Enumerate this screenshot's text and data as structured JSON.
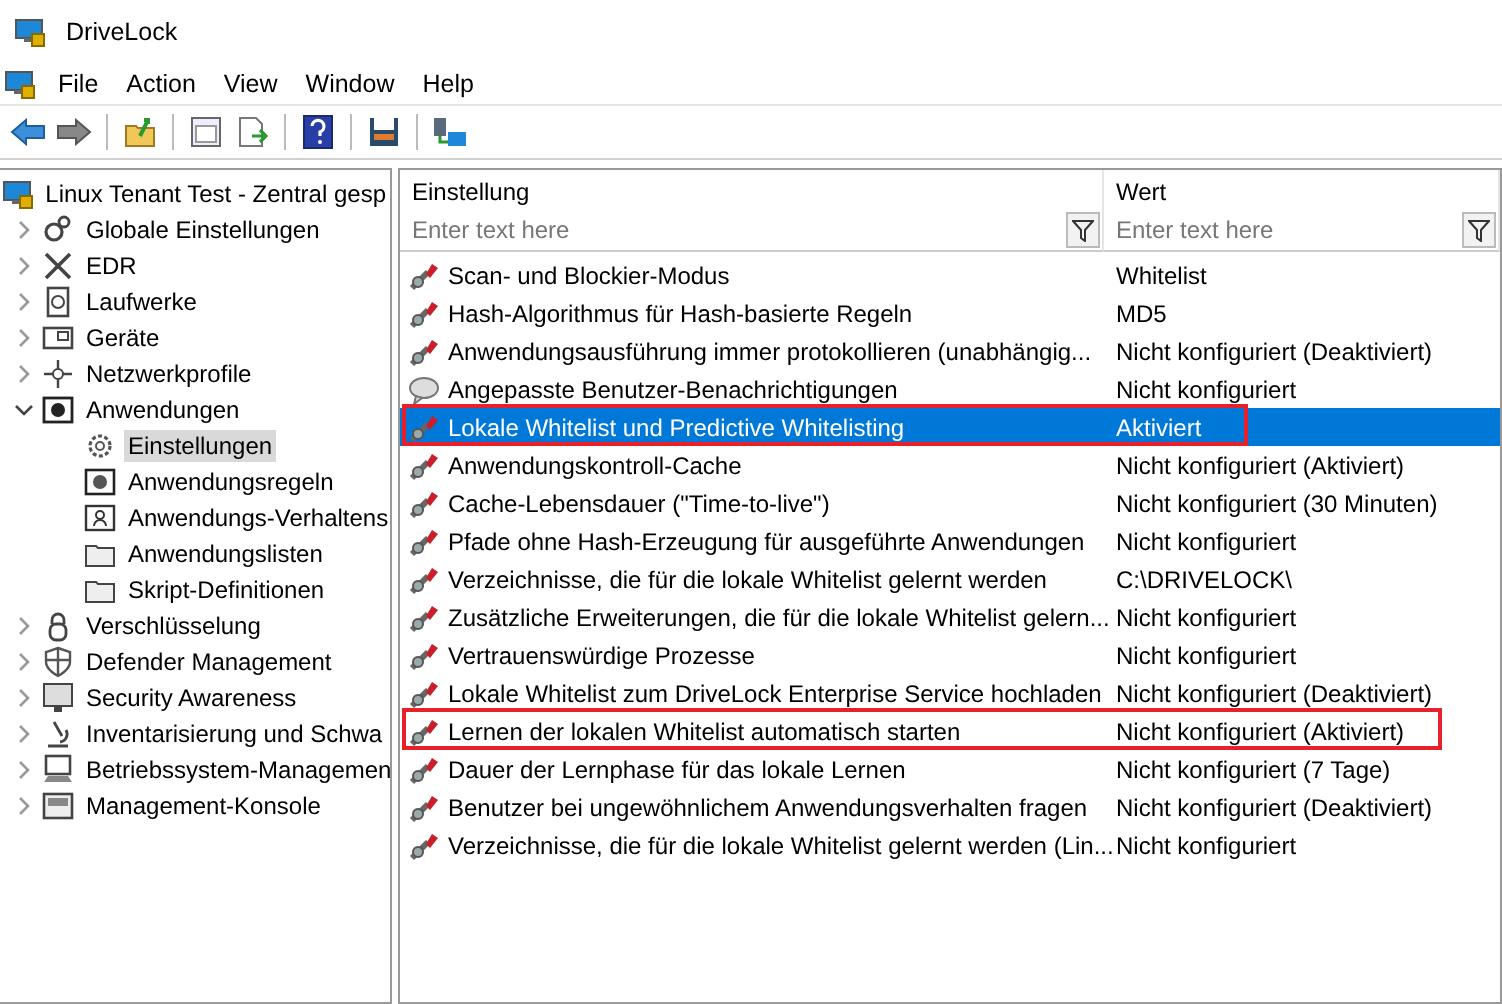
{
  "window": {
    "title": "DriveLock"
  },
  "menu": [
    "File",
    "Action",
    "View",
    "Window",
    "Help"
  ],
  "tree": {
    "label": "Linux Tenant Test - Zentral gesp",
    "children": [
      {
        "label": "Globale Einstellungen",
        "expanded": false,
        "selected": false
      },
      {
        "label": "EDR",
        "expanded": false,
        "selected": false
      },
      {
        "label": "Laufwerke",
        "expanded": false,
        "selected": false
      },
      {
        "label": "Geräte",
        "expanded": false,
        "selected": false
      },
      {
        "label": "Netzwerkprofile",
        "expanded": false,
        "selected": false
      },
      {
        "label": "Anwendungen",
        "expanded": true,
        "selected": false,
        "children": [
          {
            "label": "Einstellungen",
            "selected": true
          },
          {
            "label": "Anwendungsregeln",
            "selected": false
          },
          {
            "label": "Anwendungs-Verhaltens",
            "selected": false
          },
          {
            "label": "Anwendungslisten",
            "selected": false
          },
          {
            "label": "Skript-Definitionen",
            "selected": false
          }
        ]
      },
      {
        "label": "Verschlüsselung",
        "expanded": false,
        "selected": false
      },
      {
        "label": "Defender Management",
        "expanded": false,
        "selected": false
      },
      {
        "label": "Security Awareness",
        "expanded": false,
        "selected": false
      },
      {
        "label": "Inventarisierung und Schwa",
        "expanded": false,
        "selected": false
      },
      {
        "label": "Betriebssystem-Managemen",
        "expanded": false,
        "selected": false
      },
      {
        "label": "Management-Konsole",
        "expanded": false,
        "selected": false
      }
    ]
  },
  "table": {
    "columns": [
      {
        "title": "Einstellung",
        "placeholder": "Enter text here"
      },
      {
        "title": "Wert",
        "placeholder": "Enter text here"
      }
    ],
    "rows": [
      {
        "kind": "setting",
        "name": "Scan- und Blockier-Modus",
        "value": "Whitelist",
        "selected": false,
        "highlighted": false
      },
      {
        "kind": "setting",
        "name": "Hash-Algorithmus für Hash-basierte Regeln",
        "value": "MD5",
        "selected": false,
        "highlighted": false
      },
      {
        "kind": "setting",
        "name": "Anwendungsausführung immer protokollieren (unabhängig...",
        "value": "Nicht konfiguriert (Deaktiviert)",
        "selected": false,
        "highlighted": false
      },
      {
        "kind": "message",
        "name": "Angepasste Benutzer-Benachrichtigungen",
        "value": "Nicht konfiguriert",
        "selected": false,
        "highlighted": false
      },
      {
        "kind": "setting",
        "name": "Lokale Whitelist und Predictive Whitelisting",
        "value": "Aktiviert",
        "selected": true,
        "highlighted": true
      },
      {
        "kind": "setting",
        "name": "Anwendungskontroll-Cache",
        "value": "Nicht konfiguriert (Aktiviert)",
        "selected": false,
        "highlighted": false
      },
      {
        "kind": "setting",
        "name": "Cache-Lebensdauer (\"Time-to-live\")",
        "value": "Nicht konfiguriert (30 Minuten)",
        "selected": false,
        "highlighted": false
      },
      {
        "kind": "setting",
        "name": "Pfade ohne Hash-Erzeugung für ausgeführte Anwendungen",
        "value": "Nicht konfiguriert",
        "selected": false,
        "highlighted": false
      },
      {
        "kind": "setting",
        "name": "Verzeichnisse, die für die lokale Whitelist gelernt werden",
        "value": "C:\\DRIVELOCK\\",
        "selected": false,
        "highlighted": false
      },
      {
        "kind": "setting",
        "name": "Zusätzliche Erweiterungen, die für die lokale Whitelist gelern...",
        "value": "Nicht konfiguriert",
        "selected": false,
        "highlighted": false
      },
      {
        "kind": "setting",
        "name": "Vertrauenswürdige Prozesse",
        "value": "Nicht konfiguriert",
        "selected": false,
        "highlighted": false
      },
      {
        "kind": "setting",
        "name": "Lokale Whitelist zum DriveLock Enterprise Service hochladen",
        "value": "Nicht konfiguriert (Deaktiviert)",
        "selected": false,
        "highlighted": false
      },
      {
        "kind": "setting",
        "name": "Lernen der lokalen Whitelist automatisch starten",
        "value": "Nicht konfiguriert (Aktiviert)",
        "selected": false,
        "highlighted": true
      },
      {
        "kind": "setting",
        "name": "Dauer der Lernphase für das lokale Lernen",
        "value": "Nicht konfiguriert (7 Tage)",
        "selected": false,
        "highlighted": false
      },
      {
        "kind": "setting",
        "name": "Benutzer bei ungewöhnlichem Anwendungsverhalten fragen",
        "value": "Nicht konfiguriert (Deaktiviert)",
        "selected": false,
        "highlighted": false
      },
      {
        "kind": "setting",
        "name": "Verzeichnisse, die für die lokale Whitelist gelernt werden (Lin...",
        "value": "Nicht konfiguriert",
        "selected": false,
        "highlighted": false
      }
    ]
  }
}
